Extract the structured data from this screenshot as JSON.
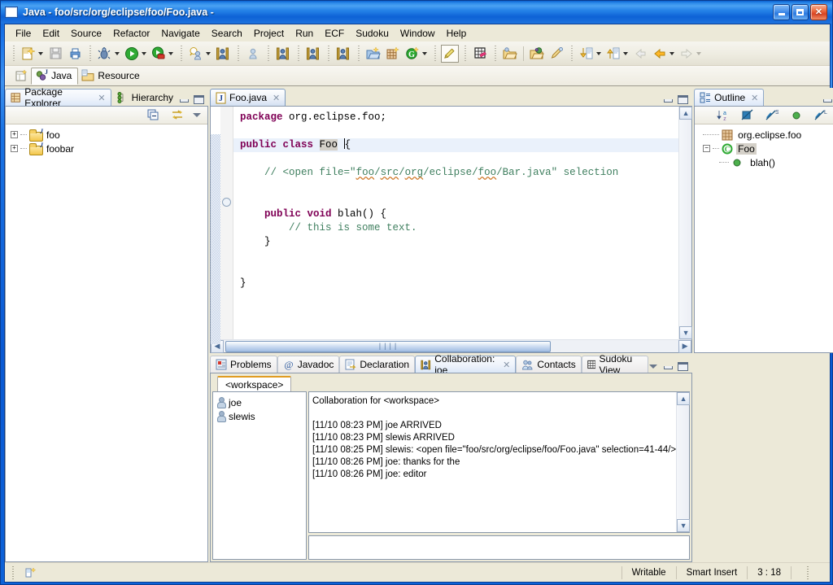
{
  "window": {
    "app": "Java",
    "title_separator": "-",
    "file_path": "foo/src/org/eclipse/foo/Foo.java",
    "title_trailing": "-",
    "minimize_label": "Minimize",
    "maximize_label": "Maximize",
    "close_label": "Close"
  },
  "menu": {
    "items": [
      "File",
      "Edit",
      "Source",
      "Refactor",
      "Navigate",
      "Search",
      "Project",
      "Run",
      "ECF",
      "Sudoku",
      "Window",
      "Help"
    ]
  },
  "toolbar": {
    "groups": [
      [
        "new-wizard",
        "new-dropdown",
        "save",
        "print"
      ],
      [
        "debug",
        "debug-dropdown",
        "run",
        "run-dropdown",
        "external-tools",
        "external-tools-dropdown"
      ],
      [
        "open-type-search",
        "open-type-dropdown",
        "ecf-collab"
      ],
      [
        "ecf-user"
      ],
      [
        "ecf-collab-2"
      ],
      [
        "ecf-collab-3"
      ],
      [
        "ecf-collab-4"
      ],
      [
        "open-task",
        "new-table",
        "new-g"
      ],
      [
        "pencil-marker"
      ],
      [
        "sudoku-view"
      ],
      [
        "open-resource",
        "search-folder",
        "search-pencil"
      ],
      [
        "next-annotation",
        "next-dropdown",
        "prev-annotation",
        "prev-dropdown",
        "back-history",
        "back-dropdown",
        "forward-history",
        "forward-dropdown"
      ]
    ]
  },
  "perspectives": {
    "open_label": "Open Perspective",
    "items": [
      {
        "label": "Java",
        "active": true,
        "icon": "java-perspective-icon"
      },
      {
        "label": "Resource",
        "active": false,
        "icon": "resource-perspective-icon"
      }
    ]
  },
  "package_explorer": {
    "tabs": [
      {
        "label": "Package Explorer",
        "active": true,
        "closable": true,
        "icon": "package-explorer-icon"
      },
      {
        "label": "Hierarchy",
        "active": false,
        "closable": false,
        "icon": "hierarchy-icon"
      }
    ],
    "toolbar": [
      "collapse-all-icon",
      "link-with-editor-icon",
      "view-menu-icon"
    ],
    "tree": [
      {
        "label": "foo",
        "expandable": "+",
        "icon": "java-project-icon"
      },
      {
        "label": "foobar",
        "expandable": "+",
        "icon": "java-project-icon"
      }
    ]
  },
  "editor": {
    "tab": {
      "label": "Foo.java",
      "icon": "java-file-icon",
      "closable": true
    },
    "lines": [
      {
        "id": 1,
        "highlight": false,
        "segments": [
          {
            "text": "package",
            "style": "kw"
          },
          {
            "text": " org.eclipse.foo;",
            "style": "plain"
          }
        ]
      },
      {
        "id": 2,
        "highlight": false,
        "segments": []
      },
      {
        "id": 3,
        "highlight": true,
        "segments": [
          {
            "text": "public class ",
            "style": "kw"
          },
          {
            "text": "Foo",
            "style": "sel"
          },
          {
            "text": " ",
            "style": "plain"
          },
          {
            "text": "{",
            "style": "caret-before"
          }
        ]
      },
      {
        "id": 4,
        "highlight": false,
        "segments": []
      },
      {
        "id": 5,
        "highlight": false,
        "segments": [
          {
            "text": "    // <open file=\"foo/src/org/eclipse/foo/Bar.java\" selection",
            "style": "cm"
          }
        ]
      },
      {
        "id": 6,
        "highlight": false,
        "segments": []
      },
      {
        "id": 7,
        "highlight": false,
        "segments": []
      },
      {
        "id": 8,
        "highlight": false,
        "segments": [
          {
            "text": "   ",
            "style": "plain"
          },
          {
            "text": "public void ",
            "style": "kw"
          },
          {
            "text": "blah() {",
            "style": "plain"
          }
        ]
      },
      {
        "id": 9,
        "highlight": false,
        "segments": [
          {
            "text": "       ",
            "style": "plain"
          },
          {
            "text": "// this is some text.",
            "style": "cm"
          }
        ]
      },
      {
        "id": 10,
        "highlight": false,
        "segments": [
          {
            "text": "   }",
            "style": "plain"
          }
        ]
      },
      {
        "id": 11,
        "highlight": false,
        "segments": []
      },
      {
        "id": 12,
        "highlight": false,
        "segments": []
      },
      {
        "id": 13,
        "highlight": false,
        "segments": [
          {
            "text": "}",
            "style": "plain"
          }
        ]
      }
    ],
    "scroll_left_label": "◀",
    "scroll_right_label": "▶",
    "scroll_up_label": "▲",
    "scroll_down_label": "▼",
    "hthumb_grip": "||||"
  },
  "outline": {
    "tab": {
      "label": "Outline",
      "icon": "outline-icon",
      "closable": true
    },
    "toolbar": [
      "sort-az-icon",
      "hide-fields-icon",
      "hide-static-icon",
      "hide-public-icon",
      "hide-local-icon",
      "view-menu-icon"
    ],
    "tree": [
      {
        "label": "org.eclipse.foo",
        "icon": "package-icon",
        "indent": 1,
        "expandable": "",
        "selected": false
      },
      {
        "label": "Foo",
        "icon": "class-icon",
        "indent": 1,
        "expandable": "-",
        "selected": true
      },
      {
        "label": "blah()",
        "icon": "method-public-icon",
        "indent": 2,
        "expandable": "",
        "selected": false
      }
    ]
  },
  "bottom_panel": {
    "tabs": [
      {
        "label": "Problems",
        "active": false,
        "closable": false,
        "icon": "problems-icon"
      },
      {
        "label": "Javadoc",
        "active": false,
        "closable": false,
        "icon": "javadoc-icon"
      },
      {
        "label": "Declaration",
        "active": false,
        "closable": false,
        "icon": "declaration-icon"
      },
      {
        "label": "Collaboration: joe",
        "active": true,
        "closable": true,
        "icon": "collaboration-icon"
      },
      {
        "label": "Contacts",
        "active": false,
        "closable": false,
        "icon": "contacts-icon"
      },
      {
        "label": "Sudoku View",
        "active": false,
        "closable": false,
        "icon": "sudoku-icon"
      }
    ],
    "controls": [
      "view-menu-icon",
      "minimize-icon",
      "maximize-icon"
    ]
  },
  "collaboration": {
    "workspace_tab": "<workspace>",
    "roster": [
      {
        "name": "joe",
        "icon": "user-icon"
      },
      {
        "name": "slewis",
        "icon": "user-icon"
      }
    ],
    "log": "Collaboration for <workspace>\n\n[11/10 08:23 PM] joe ARRIVED\n[11/10 08:23 PM] slewis ARRIVED\n[11/10 08:25 PM] slewis: <open file=\"foo/src/org/eclipse/foo/Foo.java\" selection=41-44/>\n[11/10 08:26 PM] joe: thanks for the\n[11/10 08:26 PM] joe: editor",
    "input_value": "",
    "input_placeholder": ""
  },
  "status_bar": {
    "left_icon": "editor-state-icon",
    "writable": "Writable",
    "insert_mode": "Smart Insert",
    "cursor_position": "3 : 18"
  },
  "colors": {
    "title_blue": "#1772e8",
    "keyword_purple": "#7f0055",
    "comment_green": "#3f7f5f",
    "selection_gray": "#d4d0c8",
    "highlight_line": "#eaf1fb",
    "chrome": "#ece9d8",
    "accent_orange": "#e09c22"
  }
}
